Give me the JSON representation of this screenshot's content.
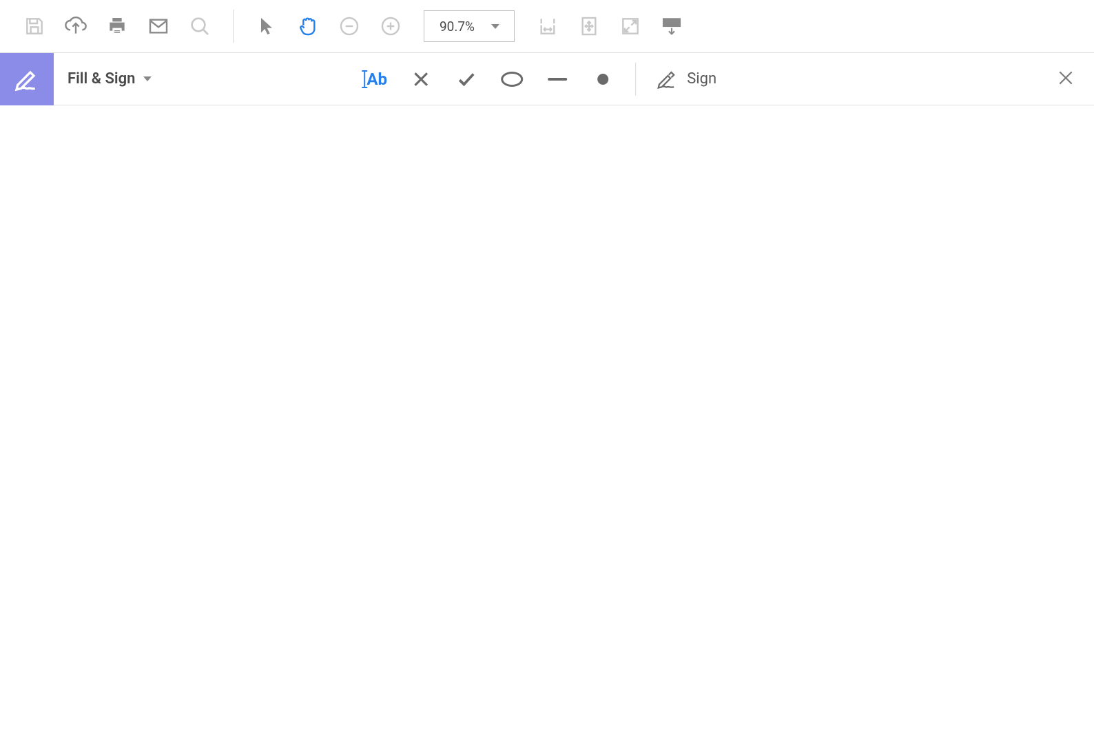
{
  "toolbar": {
    "zoom_value": "90.7%"
  },
  "secondary": {
    "fill_sign_label": "Fill & Sign",
    "text_tool_label": "Ab",
    "sign_label": "Sign"
  }
}
